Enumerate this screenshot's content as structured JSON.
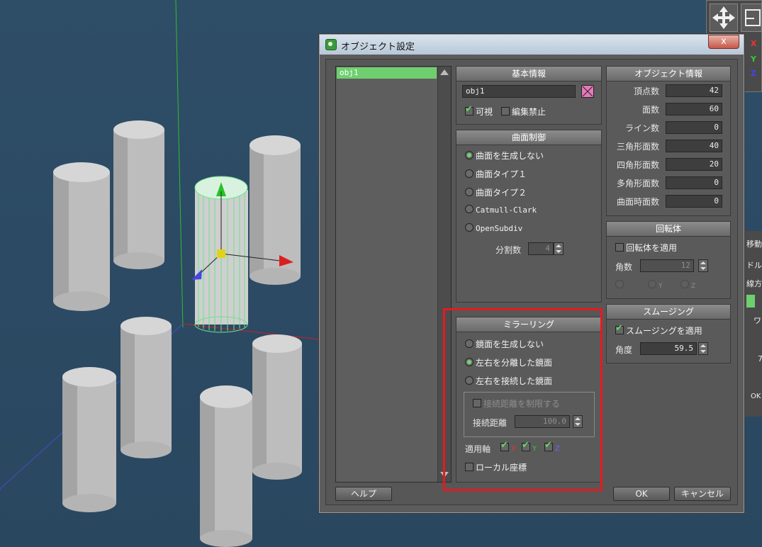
{
  "dialog": {
    "title": "オブジェクト設定",
    "close": "x",
    "objects": [
      "obj1"
    ],
    "help_button": "ヘルプ",
    "ok_button": "OK",
    "cancel_button": "キャンセル"
  },
  "basic_info": {
    "header": "基本情報",
    "name_value": "obj1",
    "visible_label": "可視",
    "visible_checked": true,
    "lock_label": "編集禁止",
    "lock_checked": false
  },
  "subdivision": {
    "header": "曲面制御",
    "options": [
      "曲面を生成しない",
      "曲面タイプ１",
      "曲面タイプ２",
      "Catmull-Clark",
      "OpenSubdiv"
    ],
    "selected": 0,
    "divisions_label": "分割数",
    "divisions_value": "4"
  },
  "mirroring": {
    "header": "ミラーリング",
    "options": [
      "鏡面を生成しない",
      "左右を分離した鏡面",
      "左右を接続した鏡面"
    ],
    "selected": 1,
    "limit_label": "接続距離を制限する",
    "distance_label": "接続距離",
    "distance_value": "100.0",
    "axis_label": "適用軸",
    "axes": [
      "X",
      "Y",
      "Z"
    ],
    "local_label": "ローカル座標"
  },
  "object_info": {
    "header": "オブジェクト情報",
    "rows": [
      {
        "label": "頂点数",
        "value": "42"
      },
      {
        "label": "面数",
        "value": "60"
      },
      {
        "label": "ライン数",
        "value": "0"
      },
      {
        "label": "三角形面数",
        "value": "40"
      },
      {
        "label": "四角形面数",
        "value": "20"
      },
      {
        "label": "多角形面数",
        "value": "0"
      },
      {
        "label": "曲面時面数",
        "value": "0"
      }
    ]
  },
  "lathe": {
    "header": "回転体",
    "apply_label": "回転体を適用",
    "angle_label": "角数",
    "angle_value": "12",
    "axes": [
      "X",
      "Y",
      "Z"
    ]
  },
  "smoothing": {
    "header": "スムージング",
    "apply_label": "スムージングを適用",
    "angle_label": "角度",
    "angle_value": "59.5"
  },
  "tool_panel": {
    "axes": [
      "X",
      "Y",
      "Z"
    ]
  },
  "side_panel": {
    "items": [
      "移動",
      "ドル",
      "線方向",
      "ワ",
      "7",
      "OK"
    ]
  },
  "colors": {
    "selection": "#6fcf6f",
    "object_color": "#e47ab8",
    "highlight_box": "#e8191f",
    "viewport_bg": "#2c4a63"
  }
}
